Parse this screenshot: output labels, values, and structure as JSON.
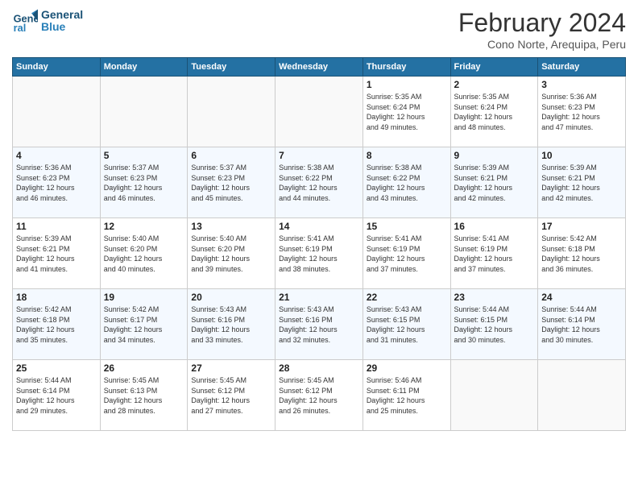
{
  "logo": {
    "line1": "General",
    "line2": "Blue"
  },
  "title": "February 2024",
  "subtitle": "Cono Norte, Arequipa, Peru",
  "weekdays": [
    "Sunday",
    "Monday",
    "Tuesday",
    "Wednesday",
    "Thursday",
    "Friday",
    "Saturday"
  ],
  "weeks": [
    [
      {
        "day": "",
        "info": ""
      },
      {
        "day": "",
        "info": ""
      },
      {
        "day": "",
        "info": ""
      },
      {
        "day": "",
        "info": ""
      },
      {
        "day": "1",
        "info": "Sunrise: 5:35 AM\nSunset: 6:24 PM\nDaylight: 12 hours\nand 49 minutes."
      },
      {
        "day": "2",
        "info": "Sunrise: 5:35 AM\nSunset: 6:24 PM\nDaylight: 12 hours\nand 48 minutes."
      },
      {
        "day": "3",
        "info": "Sunrise: 5:36 AM\nSunset: 6:23 PM\nDaylight: 12 hours\nand 47 minutes."
      }
    ],
    [
      {
        "day": "4",
        "info": "Sunrise: 5:36 AM\nSunset: 6:23 PM\nDaylight: 12 hours\nand 46 minutes."
      },
      {
        "day": "5",
        "info": "Sunrise: 5:37 AM\nSunset: 6:23 PM\nDaylight: 12 hours\nand 46 minutes."
      },
      {
        "day": "6",
        "info": "Sunrise: 5:37 AM\nSunset: 6:23 PM\nDaylight: 12 hours\nand 45 minutes."
      },
      {
        "day": "7",
        "info": "Sunrise: 5:38 AM\nSunset: 6:22 PM\nDaylight: 12 hours\nand 44 minutes."
      },
      {
        "day": "8",
        "info": "Sunrise: 5:38 AM\nSunset: 6:22 PM\nDaylight: 12 hours\nand 43 minutes."
      },
      {
        "day": "9",
        "info": "Sunrise: 5:39 AM\nSunset: 6:21 PM\nDaylight: 12 hours\nand 42 minutes."
      },
      {
        "day": "10",
        "info": "Sunrise: 5:39 AM\nSunset: 6:21 PM\nDaylight: 12 hours\nand 42 minutes."
      }
    ],
    [
      {
        "day": "11",
        "info": "Sunrise: 5:39 AM\nSunset: 6:21 PM\nDaylight: 12 hours\nand 41 minutes."
      },
      {
        "day": "12",
        "info": "Sunrise: 5:40 AM\nSunset: 6:20 PM\nDaylight: 12 hours\nand 40 minutes."
      },
      {
        "day": "13",
        "info": "Sunrise: 5:40 AM\nSunset: 6:20 PM\nDaylight: 12 hours\nand 39 minutes."
      },
      {
        "day": "14",
        "info": "Sunrise: 5:41 AM\nSunset: 6:19 PM\nDaylight: 12 hours\nand 38 minutes."
      },
      {
        "day": "15",
        "info": "Sunrise: 5:41 AM\nSunset: 6:19 PM\nDaylight: 12 hours\nand 37 minutes."
      },
      {
        "day": "16",
        "info": "Sunrise: 5:41 AM\nSunset: 6:19 PM\nDaylight: 12 hours\nand 37 minutes."
      },
      {
        "day": "17",
        "info": "Sunrise: 5:42 AM\nSunset: 6:18 PM\nDaylight: 12 hours\nand 36 minutes."
      }
    ],
    [
      {
        "day": "18",
        "info": "Sunrise: 5:42 AM\nSunset: 6:18 PM\nDaylight: 12 hours\nand 35 minutes."
      },
      {
        "day": "19",
        "info": "Sunrise: 5:42 AM\nSunset: 6:17 PM\nDaylight: 12 hours\nand 34 minutes."
      },
      {
        "day": "20",
        "info": "Sunrise: 5:43 AM\nSunset: 6:16 PM\nDaylight: 12 hours\nand 33 minutes."
      },
      {
        "day": "21",
        "info": "Sunrise: 5:43 AM\nSunset: 6:16 PM\nDaylight: 12 hours\nand 32 minutes."
      },
      {
        "day": "22",
        "info": "Sunrise: 5:43 AM\nSunset: 6:15 PM\nDaylight: 12 hours\nand 31 minutes."
      },
      {
        "day": "23",
        "info": "Sunrise: 5:44 AM\nSunset: 6:15 PM\nDaylight: 12 hours\nand 30 minutes."
      },
      {
        "day": "24",
        "info": "Sunrise: 5:44 AM\nSunset: 6:14 PM\nDaylight: 12 hours\nand 30 minutes."
      }
    ],
    [
      {
        "day": "25",
        "info": "Sunrise: 5:44 AM\nSunset: 6:14 PM\nDaylight: 12 hours\nand 29 minutes."
      },
      {
        "day": "26",
        "info": "Sunrise: 5:45 AM\nSunset: 6:13 PM\nDaylight: 12 hours\nand 28 minutes."
      },
      {
        "day": "27",
        "info": "Sunrise: 5:45 AM\nSunset: 6:12 PM\nDaylight: 12 hours\nand 27 minutes."
      },
      {
        "day": "28",
        "info": "Sunrise: 5:45 AM\nSunset: 6:12 PM\nDaylight: 12 hours\nand 26 minutes."
      },
      {
        "day": "29",
        "info": "Sunrise: 5:46 AM\nSunset: 6:11 PM\nDaylight: 12 hours\nand 25 minutes."
      },
      {
        "day": "",
        "info": ""
      },
      {
        "day": "",
        "info": ""
      }
    ]
  ]
}
